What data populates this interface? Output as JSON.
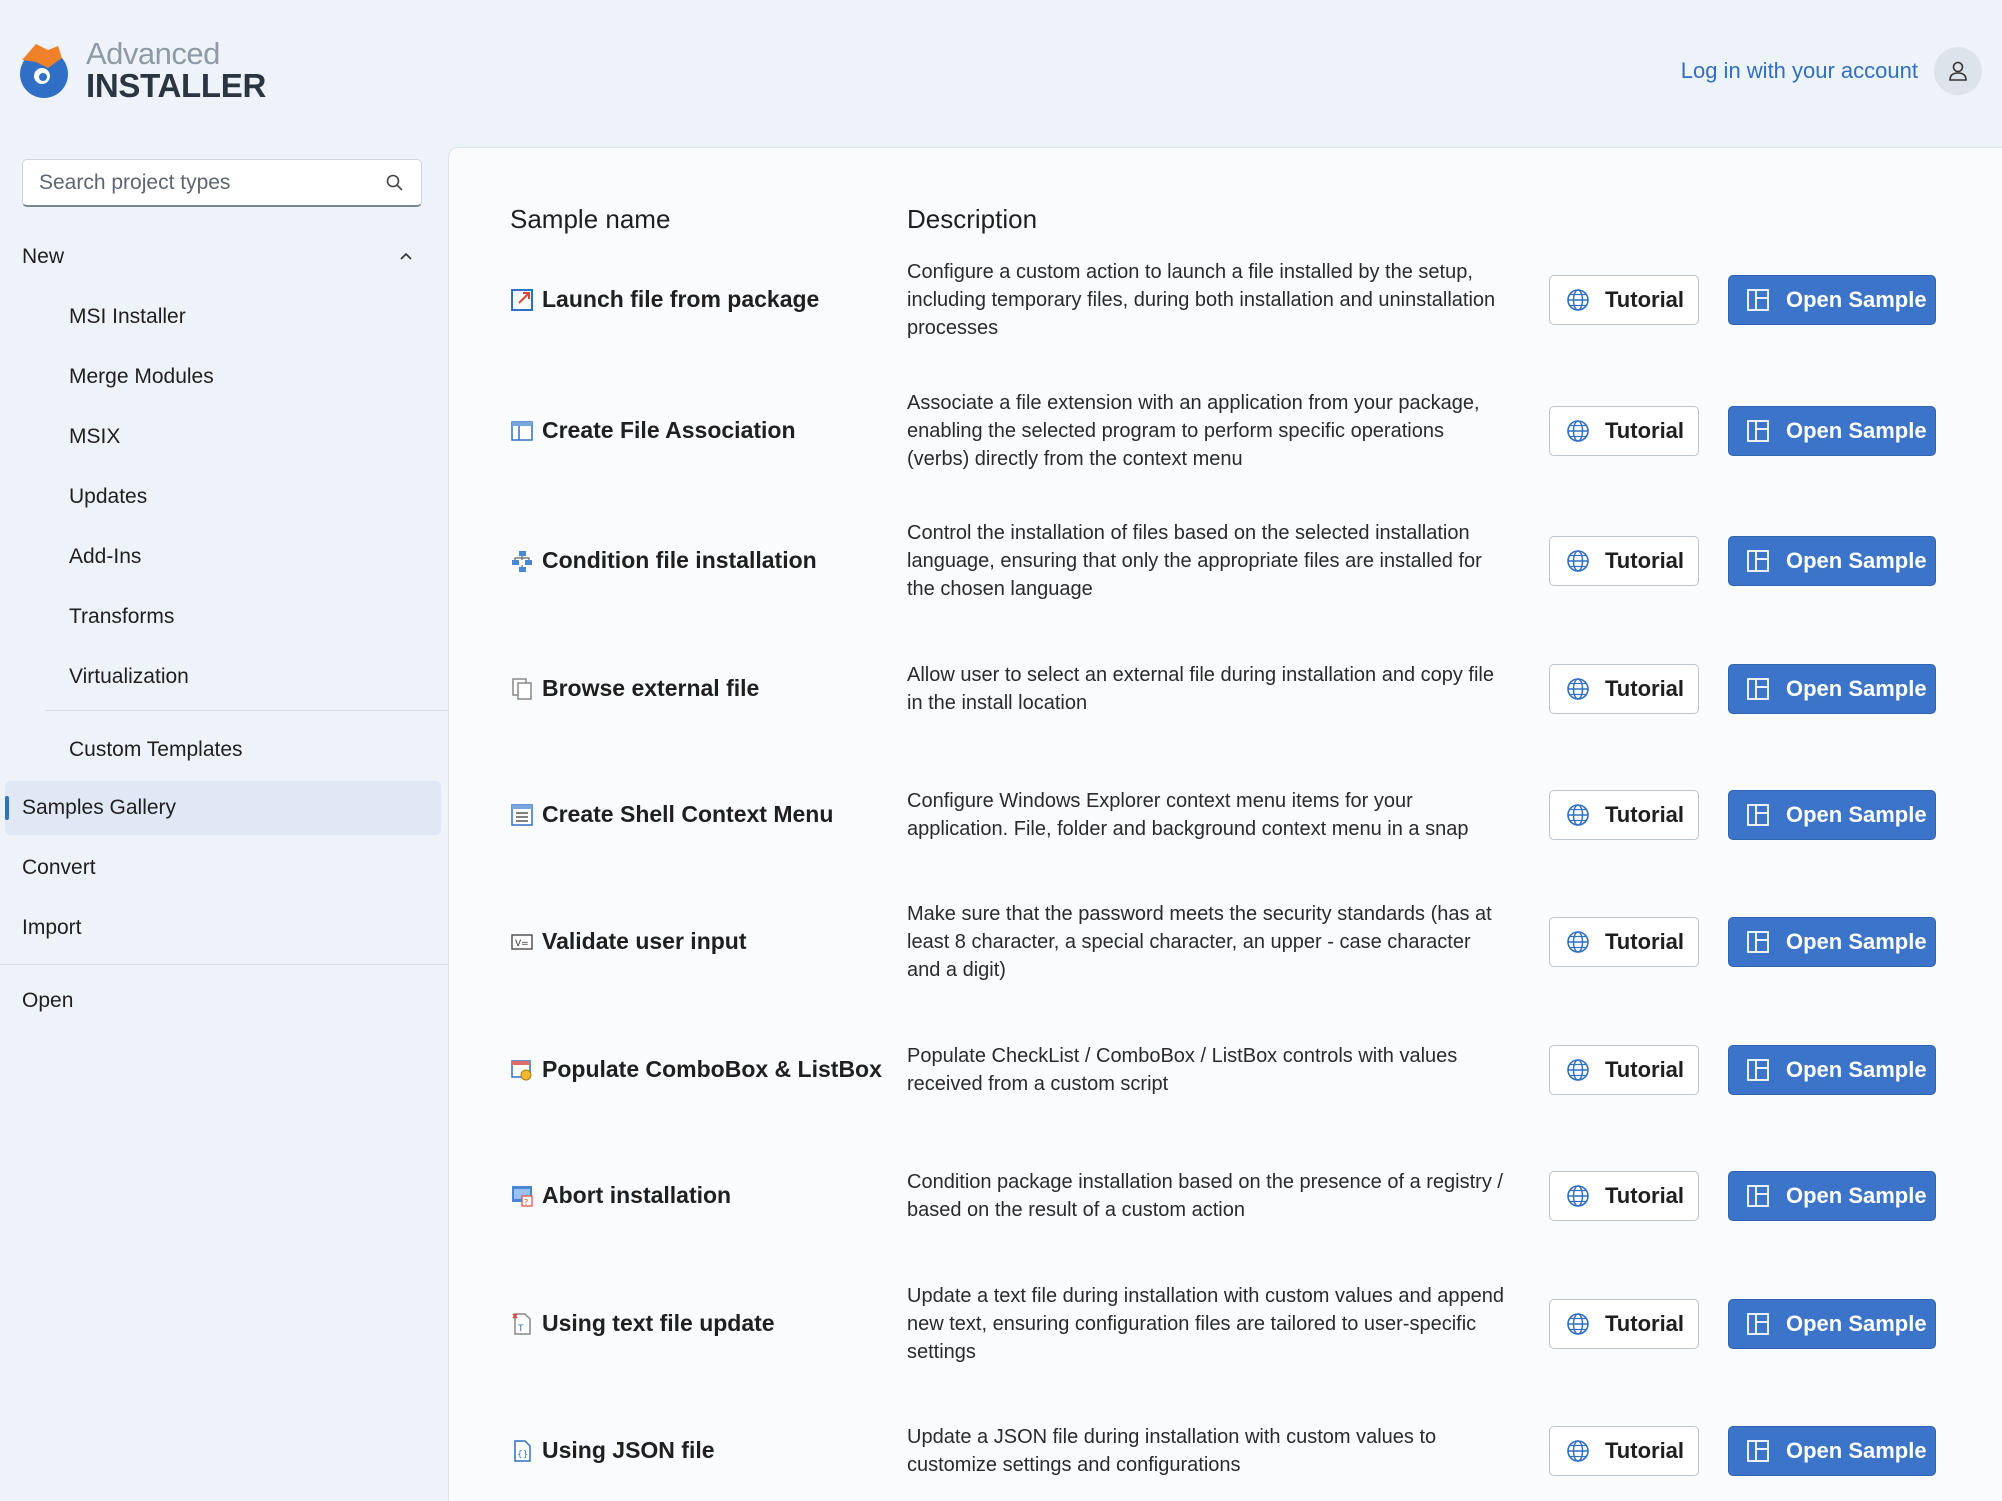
{
  "app": {
    "logo_line1": "Advanced",
    "logo_line2": "INSTALLER",
    "login_label": "Log in with your account"
  },
  "search": {
    "placeholder": "Search project types"
  },
  "sidebar": {
    "new_label": "New",
    "new_items": [
      "MSI Installer",
      "Merge Modules",
      "MSIX",
      "Updates",
      "Add-Ins",
      "Transforms",
      "Virtualization"
    ],
    "custom_templates": "Custom Templates",
    "samples_gallery": "Samples Gallery",
    "convert": "Convert",
    "import": "Import",
    "open": "Open",
    "active_item": "Samples Gallery"
  },
  "table": {
    "col_name": "Sample name",
    "col_description": "Description",
    "tutorial_label": "Tutorial",
    "open_label": "Open Sample",
    "rows": [
      {
        "name": "Launch file from package",
        "icon": "launch-file-icon",
        "description": "Configure a custom action to launch a file installed by the setup, including temporary files, during both installation and uninstallation processes"
      },
      {
        "name": "Create File Association",
        "icon": "file-association-icon",
        "description": "Associate a file extension with an application from your package, enabling the selected program to perform specific operations (verbs) directly from the context menu"
      },
      {
        "name": "Condition file installation",
        "icon": "tree-structure-icon",
        "description": "Control the installation of files based on the selected installation language, ensuring that only the appropriate files are installed for the chosen language"
      },
      {
        "name": "Browse external file",
        "icon": "copy-file-icon",
        "description": "Allow user to select an external file during installation and copy file in the install location"
      },
      {
        "name": "Create Shell Context Menu",
        "icon": "context-menu-icon",
        "description": "Configure Windows Explorer context menu items for your application. File, folder and background context menu in a snap"
      },
      {
        "name": "Validate user input",
        "icon": "validate-input-icon",
        "description": "Make sure that the password meets the security standards (has at least 8 character, a special character, an upper - case character and a digit)"
      },
      {
        "name": "Populate ComboBox & ListBox",
        "icon": "combobox-icon",
        "description": "Populate CheckList / ComboBox / ListBox controls with values received from a custom script"
      },
      {
        "name": "Abort installation",
        "icon": "abort-installation-icon",
        "description": "Condition package installation based on the presence of a registry / based on the result of a custom action"
      },
      {
        "name": "Using text file update",
        "icon": "text-file-update-icon",
        "description": "Update a text file during installation with custom values and append new text, ensuring configuration files are tailored to user-specific settings"
      },
      {
        "name": "Using JSON file",
        "icon": "json-file-icon",
        "description": "Update a JSON file during installation with custom values to customize settings and configurations"
      }
    ]
  },
  "colors": {
    "accent": "#3b74c8",
    "link": "#2f6fc6",
    "active_bg": "#dfe8f4"
  }
}
